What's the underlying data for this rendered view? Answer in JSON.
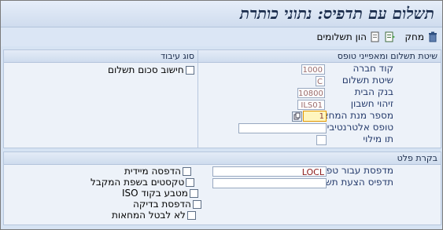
{
  "title": "תשלום עם תדפיס: נתוני כותרת",
  "toolbar": {
    "delete_label": "מחק",
    "payment_list_label": "הון תשלומים",
    "delete_icon": "trash-icon",
    "payment_list_icon": "list-icon",
    "extra_icon": "document-icon"
  },
  "section_main": {
    "header_right": "שיטת תשלום ומאפייני טופס",
    "header_left": "סוג עיבוד",
    "rows": [
      {
        "label": "קוד חברה",
        "value": "1000"
      },
      {
        "label": "שיטת תשלום",
        "value": "C"
      },
      {
        "label": "בנק הבית",
        "value": "10800"
      },
      {
        "label": "זיהוי חשבון",
        "value": "ILS01"
      },
      {
        "label": "מספר מנת המחאה",
        "value": "1"
      },
      {
        "label": "טופס אלטרנטיבי",
        "value": ""
      },
      {
        "label": "תו מילוי",
        "value": ""
      }
    ],
    "checkbox_label": "חישוב סכום תשלום"
  },
  "section_print": {
    "header": "בקרת פלט",
    "fields": [
      {
        "label": "מדפסת עבור טפסים",
        "value": "LOCL"
      },
      {
        "label": "תדפיס הצעת תשלום",
        "value": ""
      }
    ],
    "checkboxes": [
      {
        "label": "הדפסה מיידית"
      },
      {
        "label": "טקסטים בשפת המקבל"
      },
      {
        "label": "מטבע בקוד ISO"
      },
      {
        "label": "הדפסת בדיקה"
      },
      {
        "label": "לא לבטל המחאות"
      }
    ]
  }
}
